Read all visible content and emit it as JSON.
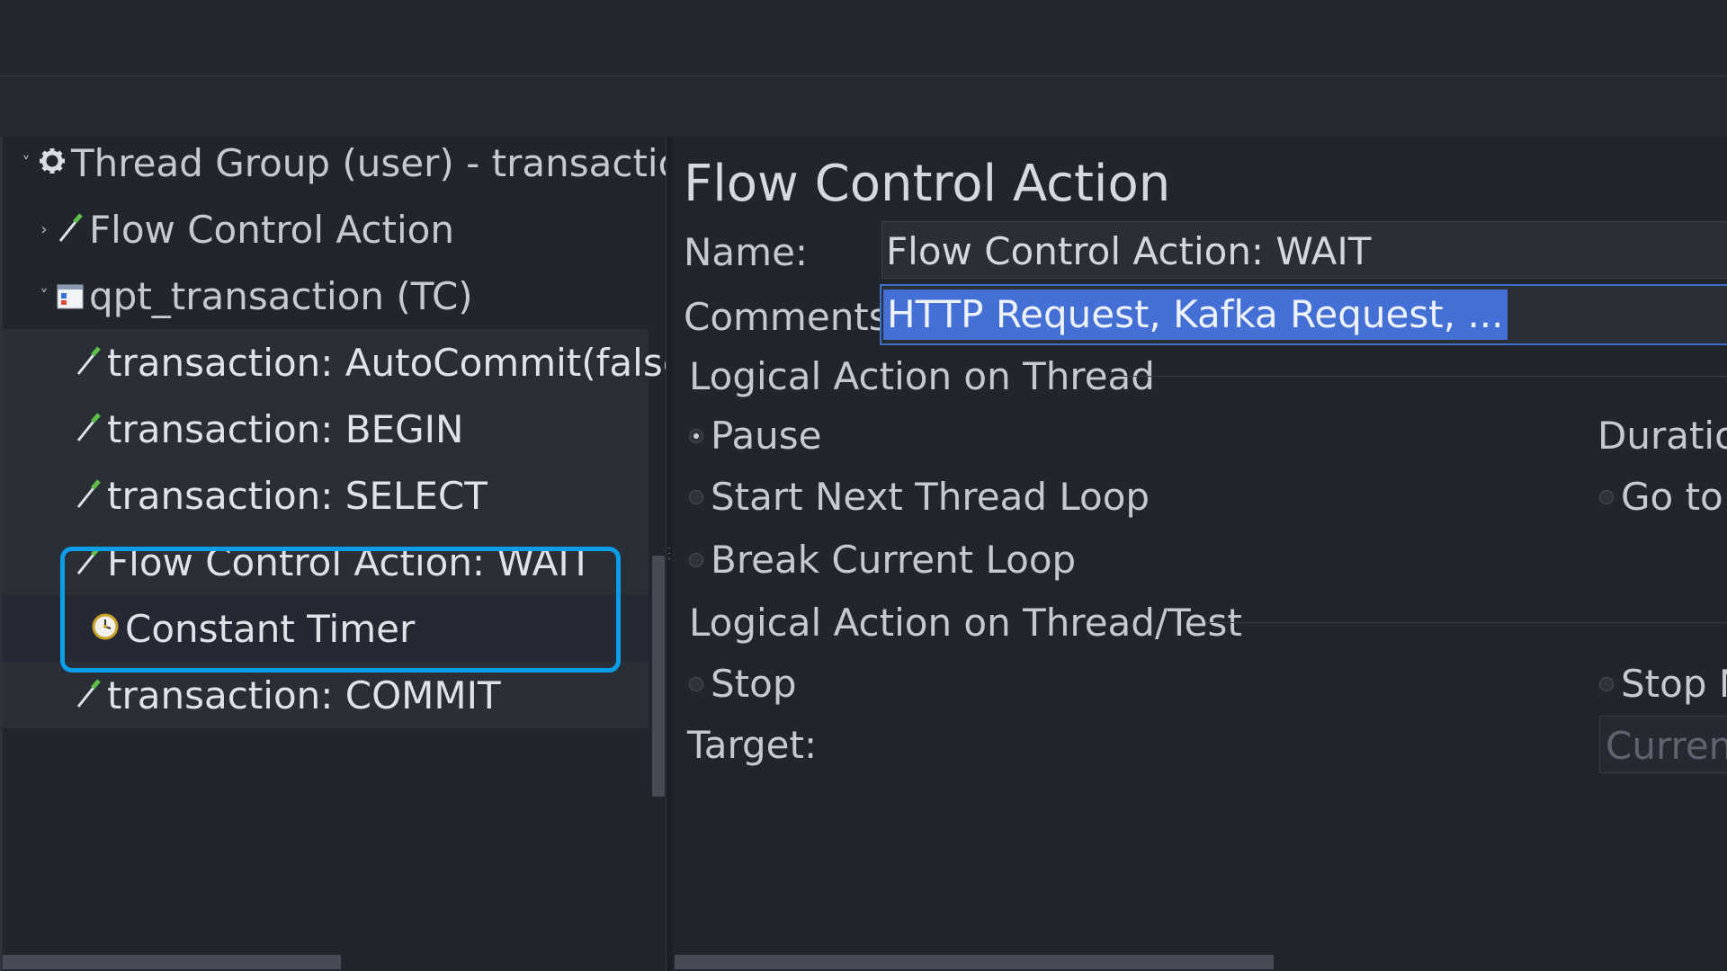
{
  "tree": {
    "root": {
      "label": "Thread Group (user) - transaction",
      "icon": "gear-icon"
    },
    "items": [
      {
        "label": "Flow Control Action",
        "icon": "pipette-icon",
        "expander": "collapsed"
      },
      {
        "label": "qpt_transaction (TC)",
        "icon": "controller-icon",
        "expander": "expanded"
      },
      {
        "label": "transaction: AutoCommit(false)",
        "icon": "pipette-icon"
      },
      {
        "label": "transaction: BEGIN",
        "icon": "pipette-icon"
      },
      {
        "label": "transaction: SELECT",
        "icon": "pipette-icon"
      },
      {
        "label": "Flow Control Action: WAIT",
        "icon": "pipette-icon",
        "selected": true
      },
      {
        "label": "Constant Timer",
        "icon": "timer-icon"
      },
      {
        "label": "transaction: COMMIT",
        "icon": "pipette-icon"
      }
    ]
  },
  "form": {
    "title": "Flow Control Action",
    "name_label": "Name:",
    "name_value": "Flow Control Action: WAIT",
    "comments_label": "Comments:",
    "comments_value": "HTTP Request, Kafka Request, ...",
    "section_thread": "Logical Action on Thread",
    "radio_pause": "Pause",
    "radio_start_next": "Start Next Thread Loop",
    "radio_break": "Break Current Loop",
    "duration_label": "Duratio",
    "radio_goto": "Go to",
    "section_test": "Logical Action on Thread/Test",
    "radio_stop": "Stop",
    "radio_stop_now": "Stop N",
    "target_label": "Target:",
    "target_value": "Current",
    "selected_radio": "Pause"
  },
  "colors": {
    "background": "#222630",
    "selection_border": "#0a9ee8",
    "text_selection": "#4470d6"
  }
}
